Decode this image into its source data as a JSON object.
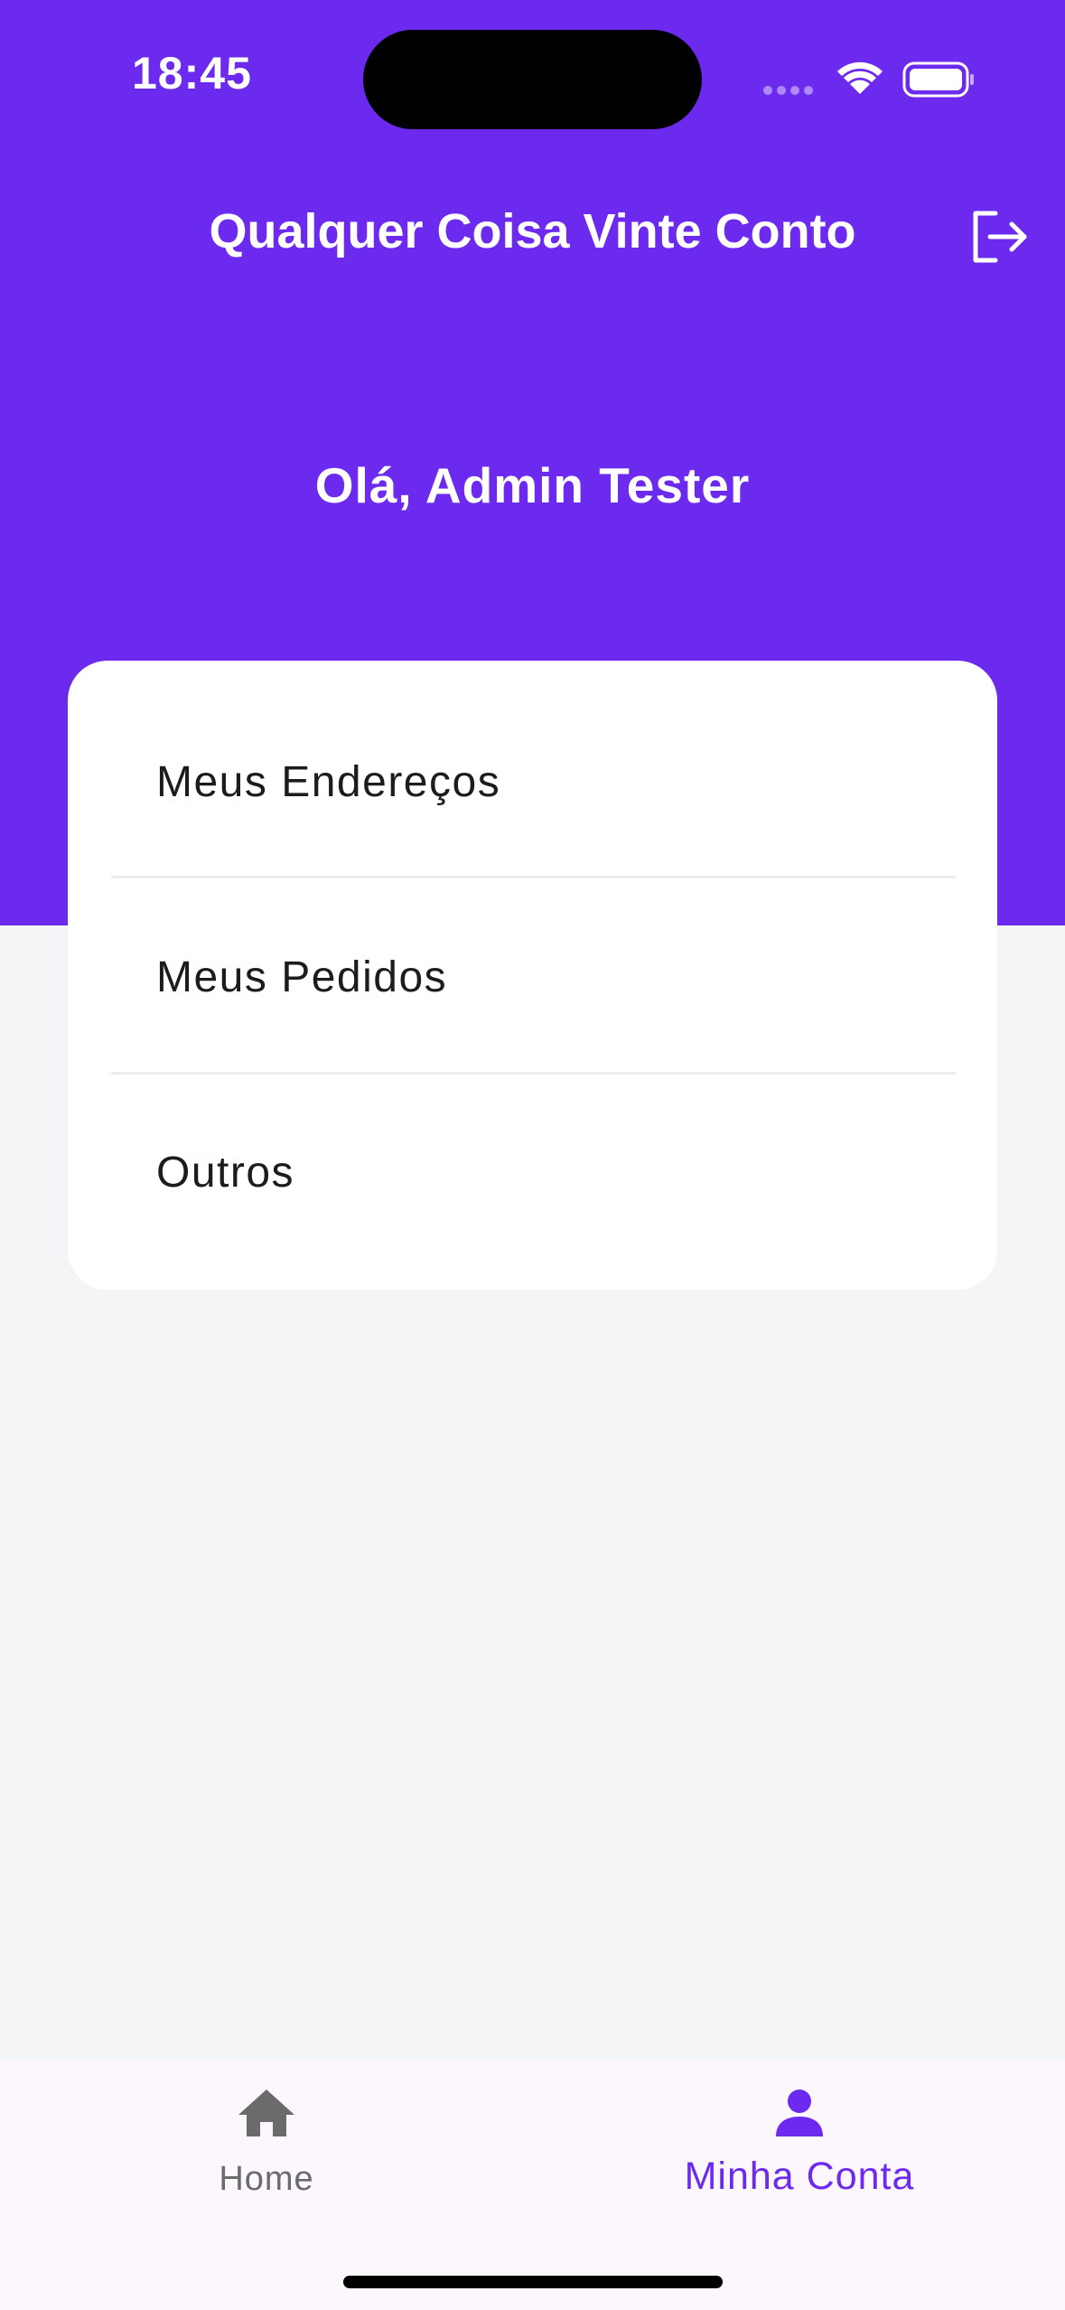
{
  "status_bar": {
    "time": "18:45",
    "icons": [
      "cellular-dots-icon",
      "wifi-icon",
      "battery-icon"
    ]
  },
  "header": {
    "title": "Qualquer Coisa Vinte Conto",
    "logout_icon": "logout-icon",
    "greeting": "Olá, Admin Tester"
  },
  "menu": {
    "items": [
      {
        "label": "Meus Endereços"
      },
      {
        "label": "Meus Pedidos"
      },
      {
        "label": "Outros"
      }
    ]
  },
  "bottom_nav": {
    "tabs": [
      {
        "label": "Home",
        "icon": "home-icon",
        "active": false
      },
      {
        "label": "Minha Conta",
        "icon": "person-icon",
        "active": true
      }
    ]
  },
  "colors": {
    "primary": "#6d2aef",
    "background": "#f4f5f7",
    "card": "#ffffff",
    "nav_background": "#fcf7fd",
    "inactive": "#6b6b6b"
  }
}
